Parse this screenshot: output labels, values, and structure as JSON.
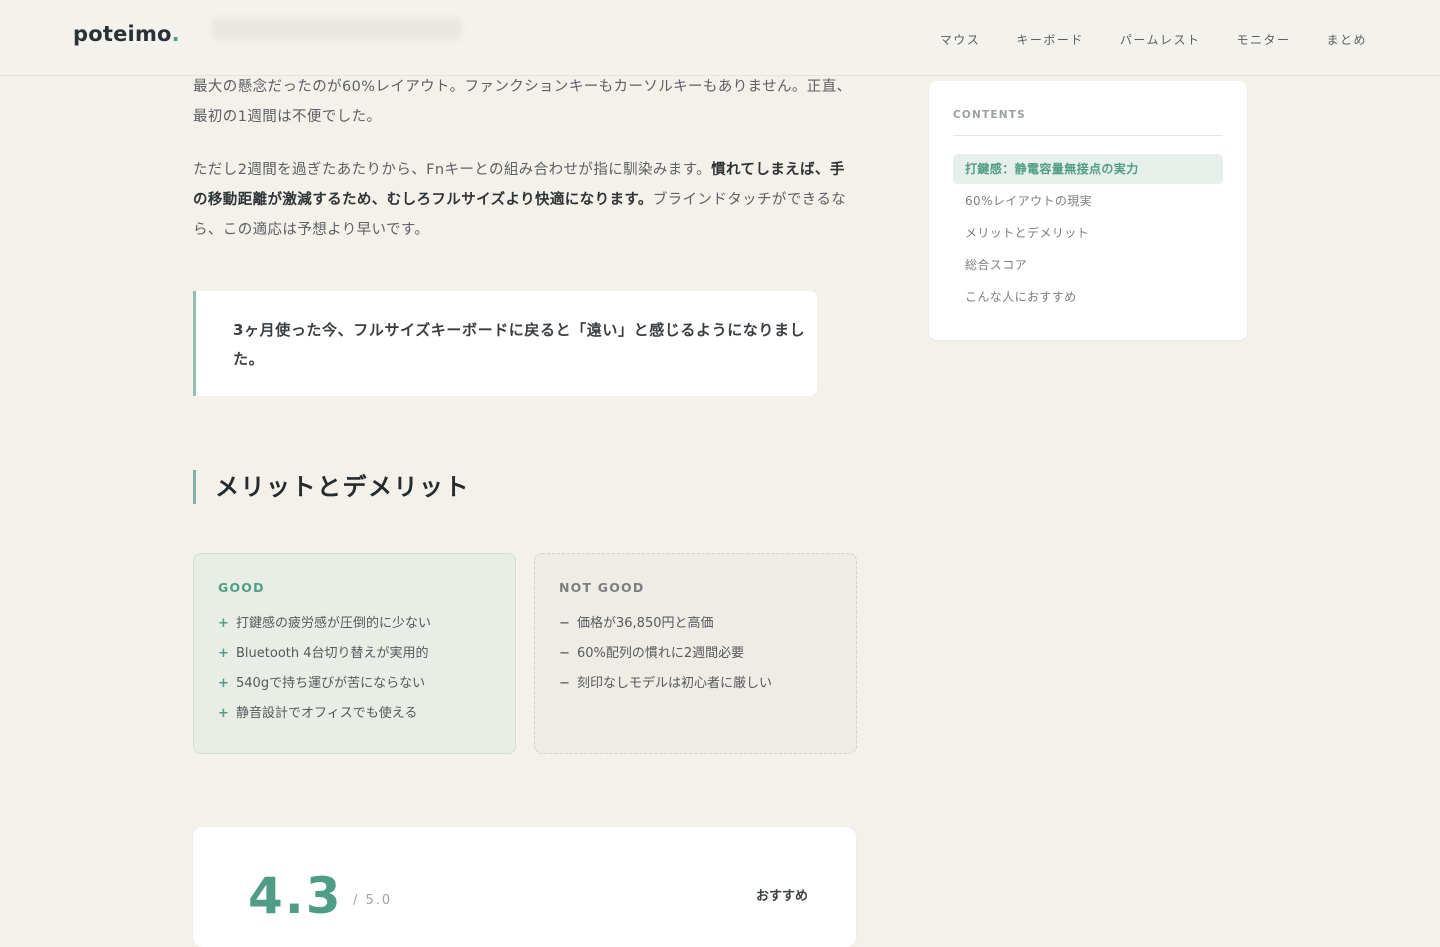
{
  "header": {
    "logo_text": "poteimo",
    "logo_dot": ".",
    "nav": [
      "マウス",
      "キーボード",
      "パームレスト",
      "モニター",
      "まとめ"
    ]
  },
  "article": {
    "p1": "最大の懸念だったのが60%レイアウト。ファンクションキーもカーソルキーもありません。正直、最初の1週間は不便でした。",
    "p2_before": "ただし2週間を過ぎたあたりから、Fnキーとの組み合わせが指に馴染みます。",
    "p2_bold": "慣れてしまえば、手の移動距離が激減するため、むしろフルサイズより快適になります。",
    "p2_after": "ブラインドタッチができるなら、この適応は予想より早いです。",
    "quote": "3ヶ月使った今、フルサイズキーボードに戻ると「遠い」と感じるようになりました。",
    "h2": "メリットとデメリット",
    "good": {
      "title": "GOOD",
      "mark": "+",
      "items": [
        "打鍵感の疲労感が圧倒的に少ない",
        "Bluetooth 4台切り替えが実用的",
        "540gで持ち運びが苦にならない",
        "静音設計でオフィスでも使える"
      ]
    },
    "bad": {
      "title": "NOT GOOD",
      "mark": "−",
      "items": [
        "価格が36,850円と高価",
        "60%配列の慣れに2週間必要",
        "刻印なしモデルは初心者に厳しい"
      ]
    },
    "score": {
      "value": "4.3",
      "max": "/ 5.0",
      "label": "おすすめ"
    }
  },
  "toc": {
    "title": "CONTENTS",
    "items": [
      "打鍵感：静電容量無接点の実力",
      "60%レイアウトの現実",
      "メリットとデメリット",
      "総合スコア",
      "こんな人におすすめ"
    ]
  },
  "colors": {
    "accent": "#4f9d86",
    "background": "#f4f1eb",
    "text": "#4a4d4e"
  }
}
